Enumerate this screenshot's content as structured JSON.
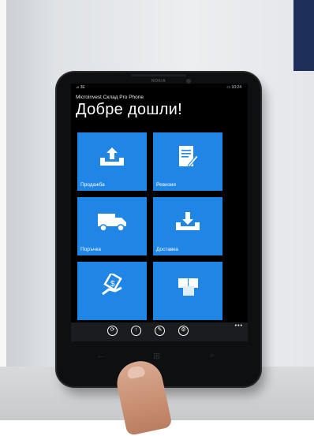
{
  "app": {
    "name": "Microinvest Склад Pro Phone",
    "title": "Добре дошли!"
  },
  "status": {
    "left": "⊿ 3E",
    "right": "▭ 10:24"
  },
  "tiles": [
    {
      "label": "Продажба",
      "icon": "upload-tray-icon"
    },
    {
      "label": "Ревизия",
      "icon": "document-edit-icon"
    },
    {
      "label": "Поръчка",
      "icon": "delivery-truck-icon"
    },
    {
      "label": "Доставка",
      "icon": "download-tray-icon"
    },
    {
      "label": "",
      "icon": "payment-hand-icon"
    },
    {
      "label": "",
      "icon": "boxes-icon"
    }
  ],
  "appbar": {
    "buttons": [
      {
        "icon": "sync-icon",
        "glyph": "⟳"
      },
      {
        "icon": "upload-icon",
        "glyph": "↑"
      },
      {
        "icon": "settings-icon",
        "glyph": "✎"
      },
      {
        "icon": "about-icon",
        "glyph": "⚙"
      }
    ],
    "more": "•••"
  },
  "phone": {
    "brand": "NOKIA",
    "nav": {
      "back": "←",
      "start": "⊞",
      "search": "⌕"
    }
  },
  "colors": {
    "tile": "#1f86e6",
    "screen_bg": "#000000",
    "text": "#ffffff"
  }
}
